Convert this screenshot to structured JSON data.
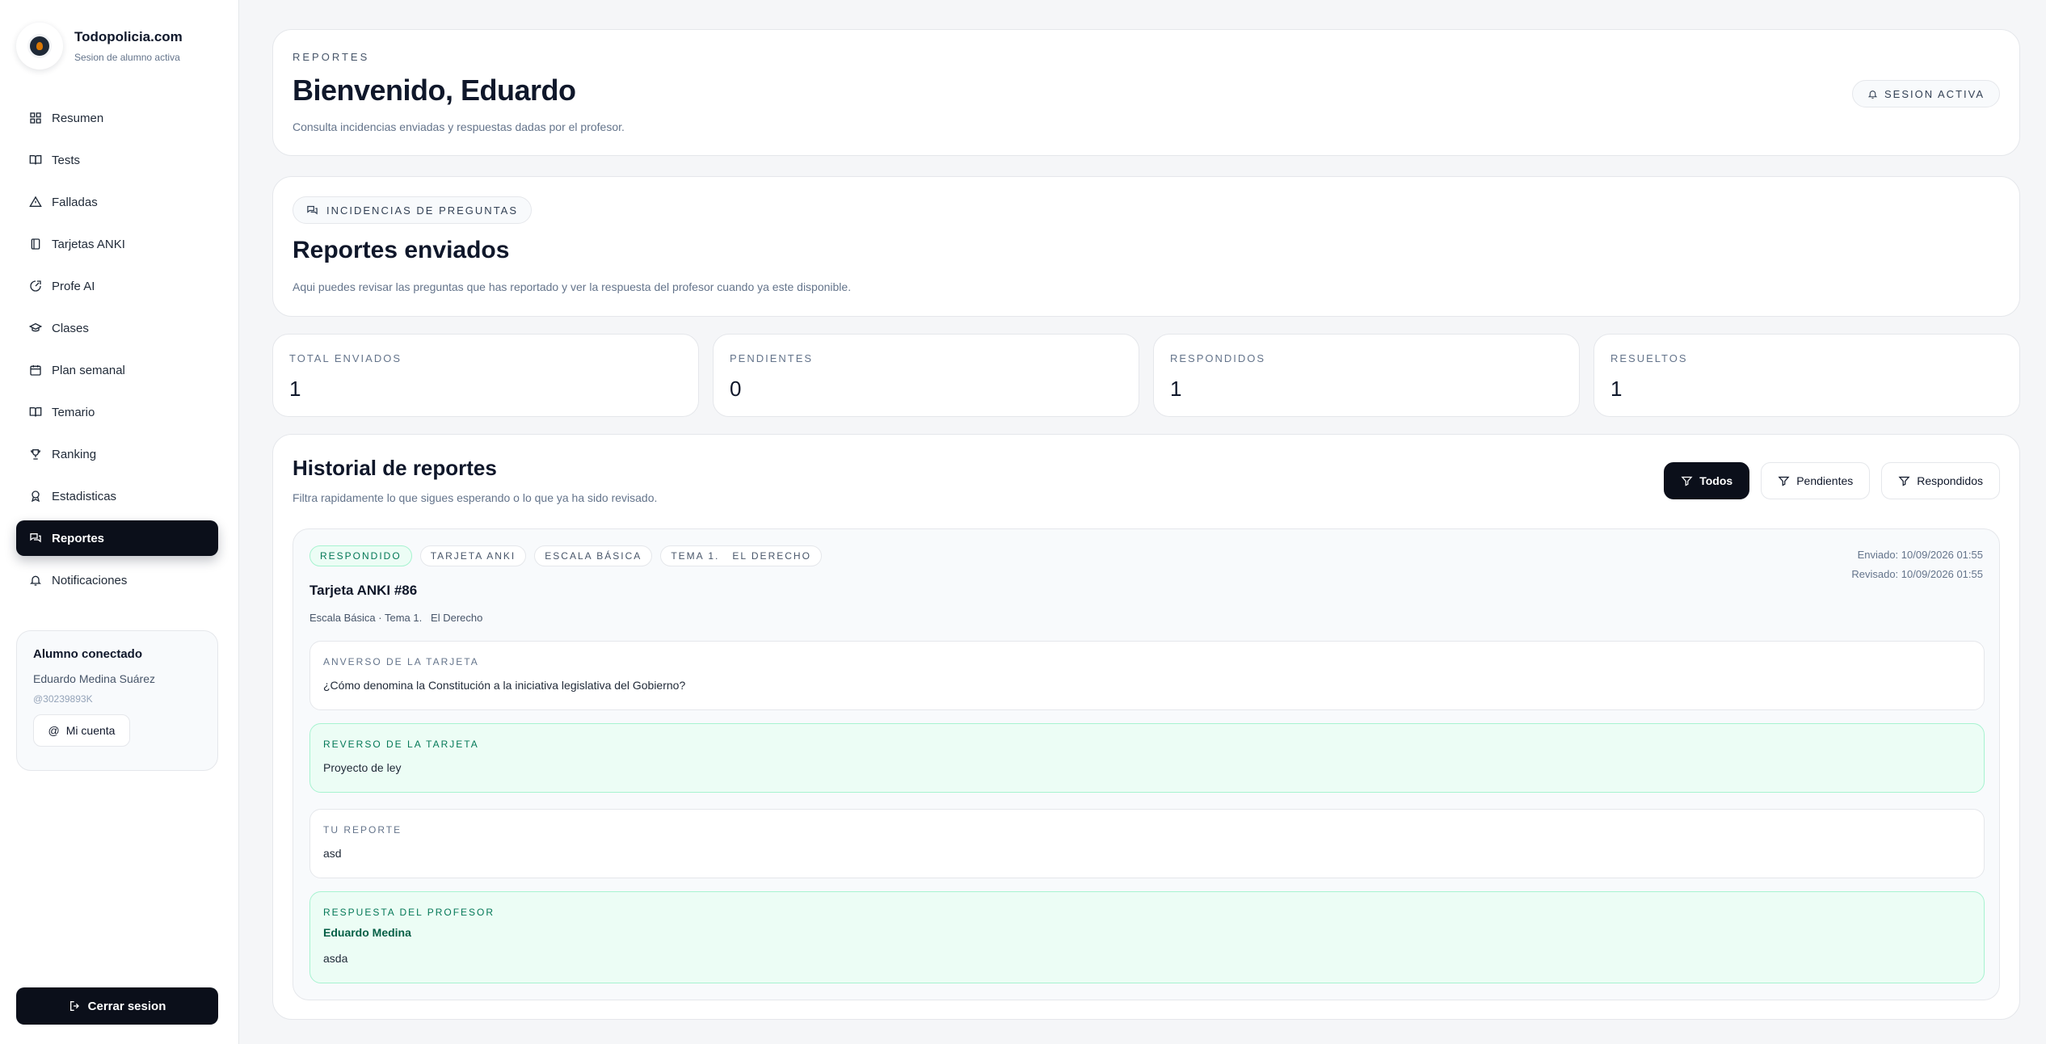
{
  "brand": {
    "name": "Todopolicia.com",
    "subtitle": "Sesion de alumno activa"
  },
  "nav": [
    {
      "label": "Resumen",
      "icon": "grid-icon"
    },
    {
      "label": "Tests",
      "icon": "book-icon"
    },
    {
      "label": "Falladas",
      "icon": "warning-icon"
    },
    {
      "label": "Tarjetas ANKI",
      "icon": "cards-icon"
    },
    {
      "label": "Profe AI",
      "icon": "ai-icon"
    },
    {
      "label": "Clases",
      "icon": "graduation-cap-icon"
    },
    {
      "label": "Plan semanal",
      "icon": "calendar-icon"
    },
    {
      "label": "Temario",
      "icon": "book-open-icon"
    },
    {
      "label": "Ranking",
      "icon": "trophy-icon"
    },
    {
      "label": "Estadisticas",
      "icon": "chart-icon"
    },
    {
      "label": "Reportes",
      "icon": "chat-icon",
      "active": true
    },
    {
      "label": "Notificaciones",
      "icon": "bell-icon"
    }
  ],
  "student": {
    "title": "Alumno conectado",
    "name": "Eduardo Medina Suárez",
    "id": "@30239893K",
    "account_label": "Mi cuenta"
  },
  "logout_label": "Cerrar sesion",
  "hero": {
    "eyebrow": "REPORTES",
    "title": "Bienvenido, Eduardo",
    "subtitle": "Consulta incidencias enviadas y respuestas dadas por el profesor.",
    "session_label": "SESION ACTIVA"
  },
  "section": {
    "category": "INCIDENCIAS DE PREGUNTAS",
    "title": "Reportes enviados",
    "subtitle": "Aqui puedes revisar las preguntas que has reportado y ver la respuesta del profesor cuando ya este disponible."
  },
  "stats": [
    {
      "label": "TOTAL ENVIADOS",
      "value": "1"
    },
    {
      "label": "PENDIENTES",
      "value": "0"
    },
    {
      "label": "RESPONDIDOS",
      "value": "1"
    },
    {
      "label": "RESUELTOS",
      "value": "1"
    }
  ],
  "history": {
    "title": "Historial de reportes",
    "subtitle": "Filtra rapidamente lo que sigues esperando o lo que ya ha sido revisado.",
    "filters": [
      "Todos",
      "Pendientes",
      "Respondidos"
    ]
  },
  "report": {
    "tags": [
      "RESPONDIDO",
      "TARJETA ANKI",
      "ESCALA BÁSICA",
      "TEMA 1.   EL DERECHO"
    ],
    "sent": "Enviado: 10/09/2026 01:55",
    "reviewed": "Revisado: 10/09/2026 01:55",
    "title": "Tarjeta ANKI #86",
    "subtitle": "Escala Básica · Tema 1.   El Derecho",
    "front_label": "ANVERSO DE LA TARJETA",
    "front_text": "¿Cómo denomina la Constitución a la iniciativa legislativa del Gobierno?",
    "back_label": "REVERSO DE LA TARJETA",
    "back_text": "Proyecto de ley",
    "report_label": "TU REPORTE",
    "report_text": "asd",
    "answer_label": "RESPUESTA DEL PROFESOR",
    "answer_author": "Eduardo Medina",
    "answer_text": "asda"
  },
  "colors": {
    "accent_dark": "#0b0f1a",
    "success_bg": "#ecfdf5",
    "success_text": "#047857"
  }
}
